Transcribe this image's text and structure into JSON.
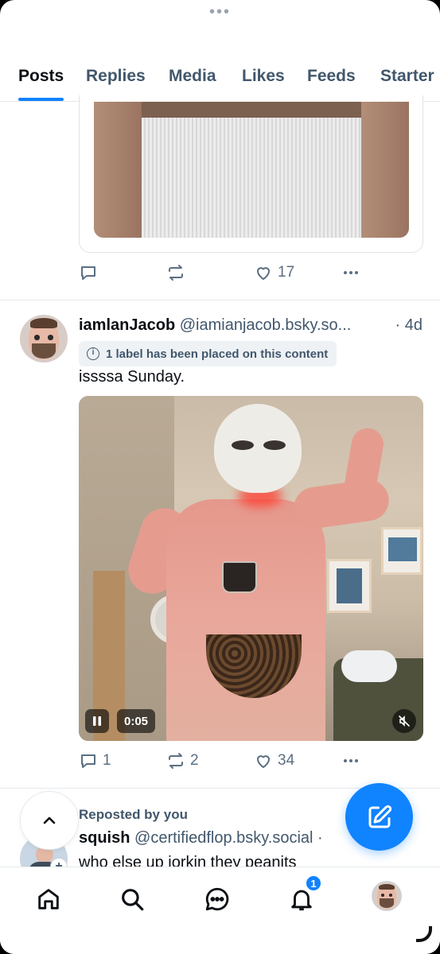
{
  "header": {
    "menu_dots": "•••"
  },
  "tabs": [
    "Posts",
    "Replies",
    "Media",
    "Likes",
    "Feeds",
    "Starter"
  ],
  "post1": {
    "actions": {
      "reply_count": "",
      "repost_count": "",
      "like_count": "17"
    }
  },
  "post2": {
    "display_name": "iamlanJacob",
    "handle": "@iamianjacob.bsky.so...",
    "time": "· 4d",
    "label_notice": "1 label has been placed on this content",
    "text": "issssa Sunday.",
    "video": {
      "time": "0:05",
      "playing": true,
      "muted": true
    },
    "actions": {
      "reply_count": "1",
      "repost_count": "2",
      "like_count": "34"
    }
  },
  "post3": {
    "repost_context": "Reposted by you",
    "display_name": "squish",
    "handle": "@certifiedflop.bsky.social",
    "handle_suffix": " ·",
    "text": "who else up jorkin they peanits"
  },
  "bottom_nav": {
    "items": [
      "home-icon",
      "search-icon",
      "chat-icon",
      "notifications-icon",
      "profile-avatar"
    ],
    "notifications_badge": "1"
  },
  "colors": {
    "accent": "#1083fe",
    "secondary_text": "#42576c",
    "divider": "#e6eaee"
  }
}
